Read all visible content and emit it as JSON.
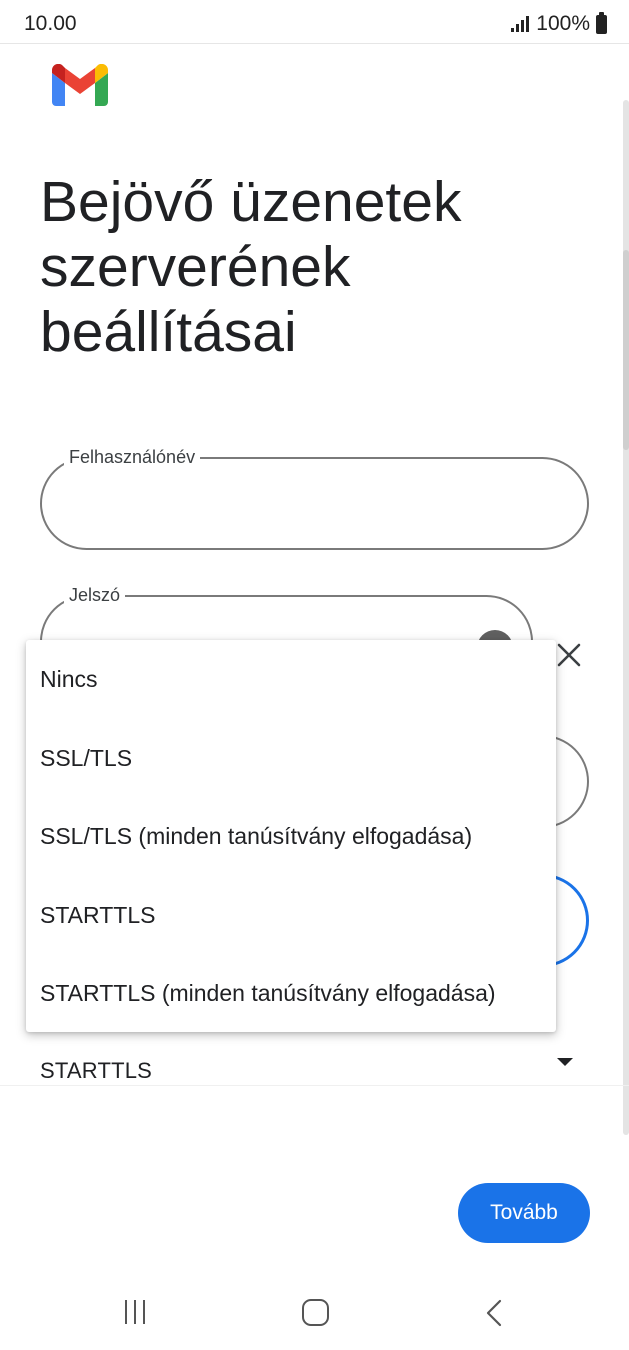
{
  "status_bar": {
    "time": "10.00",
    "battery": "100%",
    "signal_icon": "signal-bars-icon",
    "battery_icon": "battery-full-icon"
  },
  "app": {
    "logo_icon": "gmail-logo",
    "colors": {
      "red": "#EA4335",
      "blue": "#4285F4",
      "green": "#34A853",
      "yellow": "#FBBC04",
      "accent": "#1a73e8"
    }
  },
  "page": {
    "title": "Bejövő üzenetek szerverének beállításai"
  },
  "form": {
    "username_label": "Felhasználónév",
    "username_value": "",
    "password_label": "Jelszó",
    "password_value": "",
    "security_selected": "STARTTLS"
  },
  "dropdown": {
    "options": [
      "Nincs",
      "SSL/TLS",
      "SSL/TLS (minden tanúsítvány elfogadása)",
      "STARTTLS",
      "STARTTLS (minden tanúsítvány elfogadása)"
    ]
  },
  "actions": {
    "next_label": "Tovább"
  }
}
